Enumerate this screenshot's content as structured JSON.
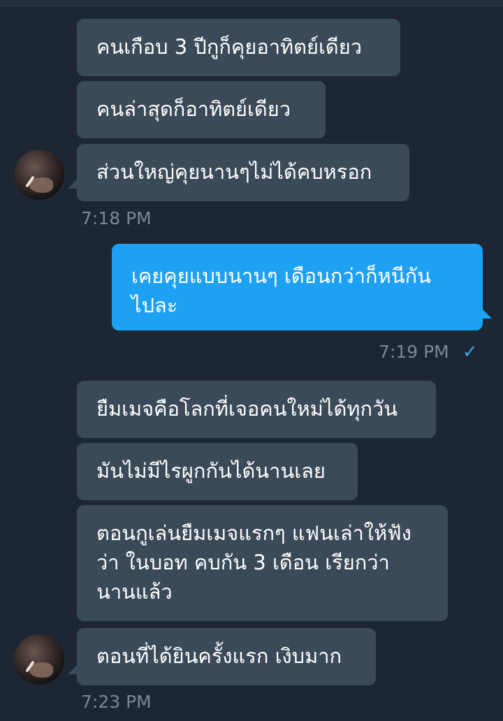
{
  "messages": [
    {
      "id": "m1",
      "text": "คนเกือบ 3 ปีกูก็คุยอาทิตย์เดียว"
    },
    {
      "id": "m2",
      "text": "คนล่าสุดก็อาทิตย์เดียว"
    },
    {
      "id": "m3",
      "text": "ส่วนใหญ่คุยนานๆไม่ได้คบหรอก"
    },
    {
      "id": "m4",
      "text": "เคยคุยแบบนานๆ เดือนกว่าก็หนีกัน ไปละ"
    },
    {
      "id": "m5",
      "text": "ยืมเมจคือโลกที่เจอคนใหม่ได้ทุกวัน"
    },
    {
      "id": "m6",
      "text": "มันไม่มีไรผูกกันได้นานเลย"
    },
    {
      "id": "m7",
      "text": "ตอนกูเล่นยืมเมจแรกๆ แฟนเล่าให้ฟังว่า ในบอท คบกัน 3 เดือน เรียกว่า นานแล้ว"
    },
    {
      "id": "m8",
      "text": "ตอนที่ได้ยินครั้งแรก เงิบมาก"
    }
  ],
  "times": {
    "t1": "7:18 PM",
    "t2": "7:19 PM",
    "t3": "7:23 PM"
  },
  "status": {
    "read_check": "✓"
  },
  "colors": {
    "background": "#1c2733",
    "incoming_bubble": "#3a4a58",
    "outgoing_bubble": "#1fa1f3",
    "timestamp": "#7a8794",
    "check": "#3aa3e8"
  },
  "icons": {
    "avatar": "avatar-photo",
    "read": "check-icon"
  }
}
